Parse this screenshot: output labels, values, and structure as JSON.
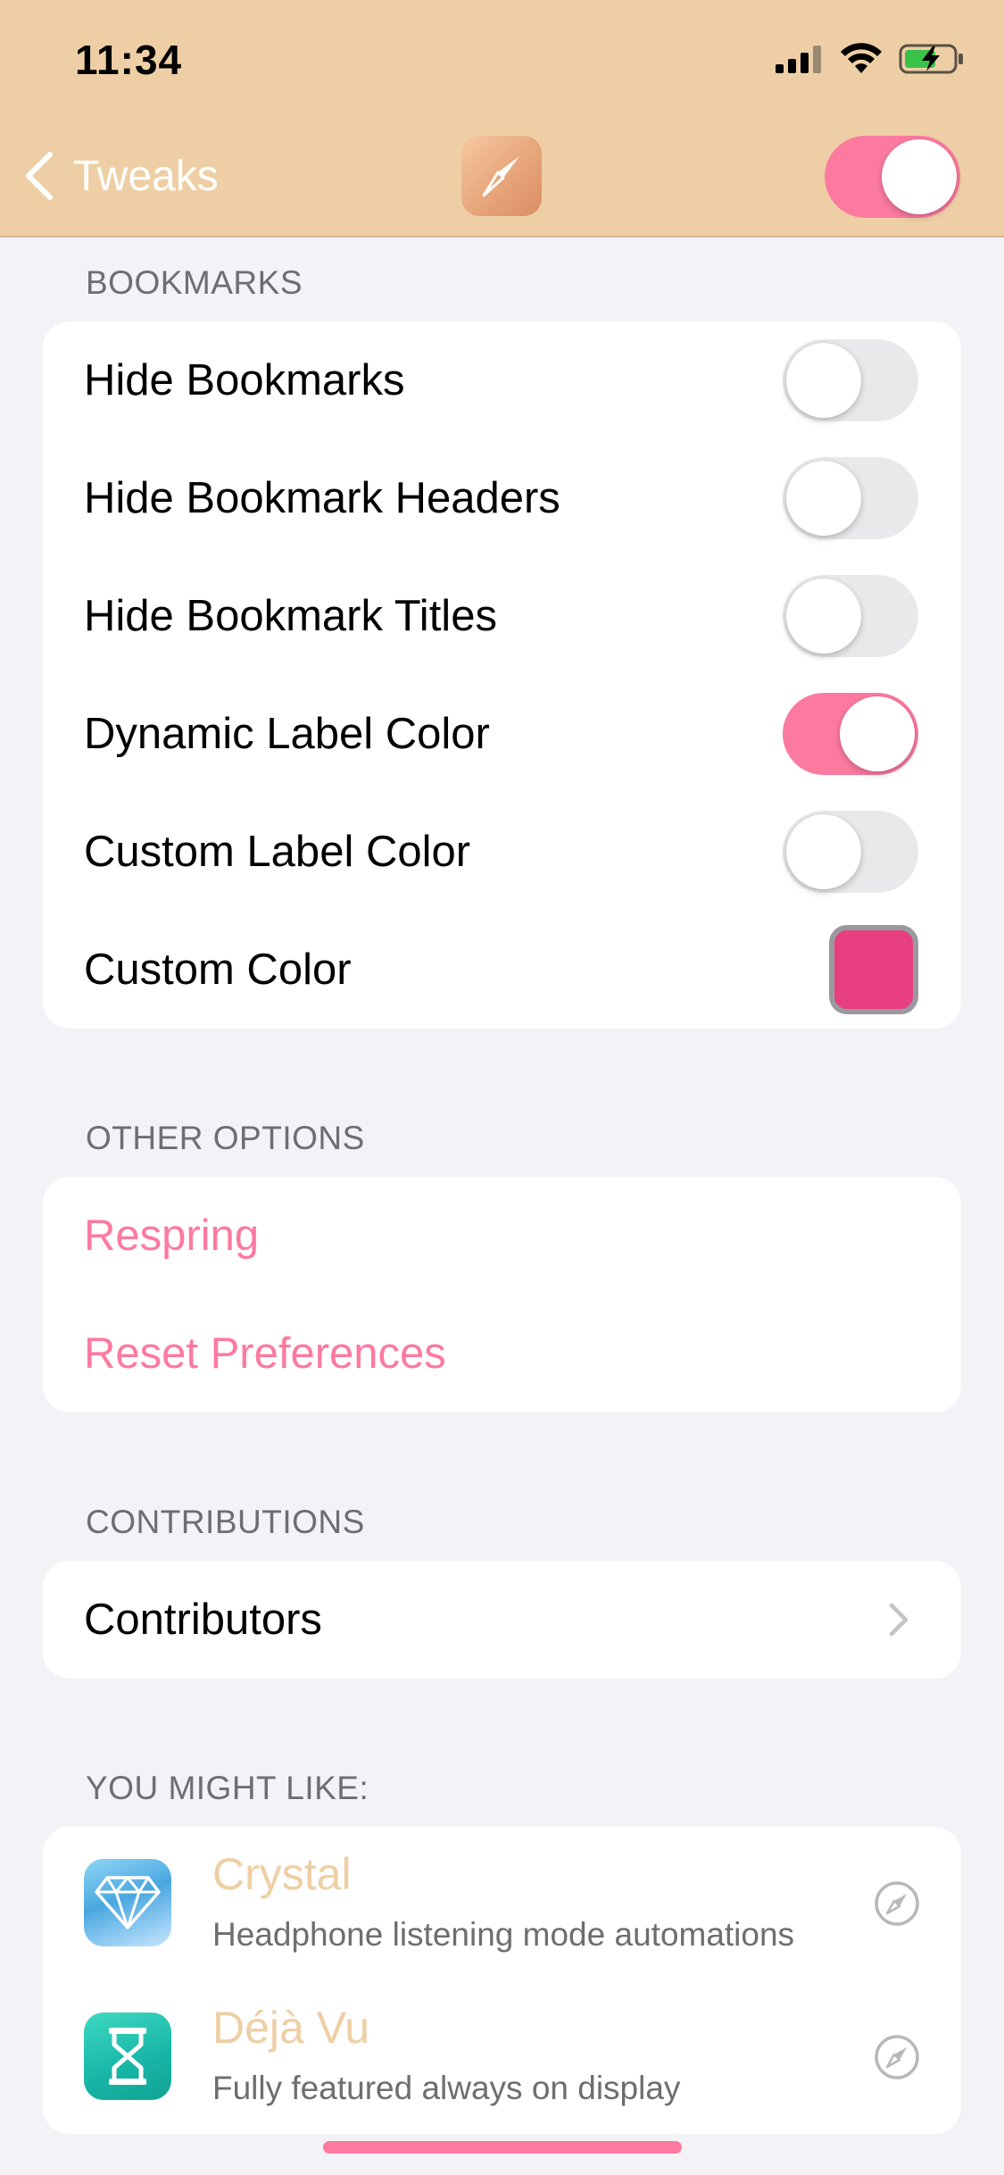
{
  "status_bar": {
    "time": "11:34"
  },
  "nav": {
    "back_label": "Tweaks",
    "master_enabled": true
  },
  "colors": {
    "accent": "#fc7a9f",
    "header_bg": "#eecfa5",
    "custom_color": "#e83f80"
  },
  "bookmarks": {
    "header": "BOOKMARKS",
    "rows": [
      {
        "label": "Hide Bookmarks",
        "on": false
      },
      {
        "label": "Hide Bookmark Headers",
        "on": false
      },
      {
        "label": "Hide Bookmark Titles",
        "on": false
      },
      {
        "label": "Dynamic Label Color",
        "on": true
      },
      {
        "label": "Custom Label Color",
        "on": false
      }
    ],
    "custom_color_label": "Custom Color"
  },
  "other_options": {
    "header": "OTHER OPTIONS",
    "respring_label": "Respring",
    "reset_label": "Reset Preferences"
  },
  "contributions": {
    "header": "CONTRIBUTIONS",
    "contributors_label": "Contributors"
  },
  "suggestions": {
    "header": "YOU MIGHT LIKE:",
    "items": [
      {
        "title": "Crystal",
        "subtitle": "Headphone listening mode automations",
        "icon": "diamond-icon"
      },
      {
        "title": "Déjà Vu",
        "subtitle": "Fully featured always on display",
        "icon": "hourglass-icon"
      }
    ]
  }
}
